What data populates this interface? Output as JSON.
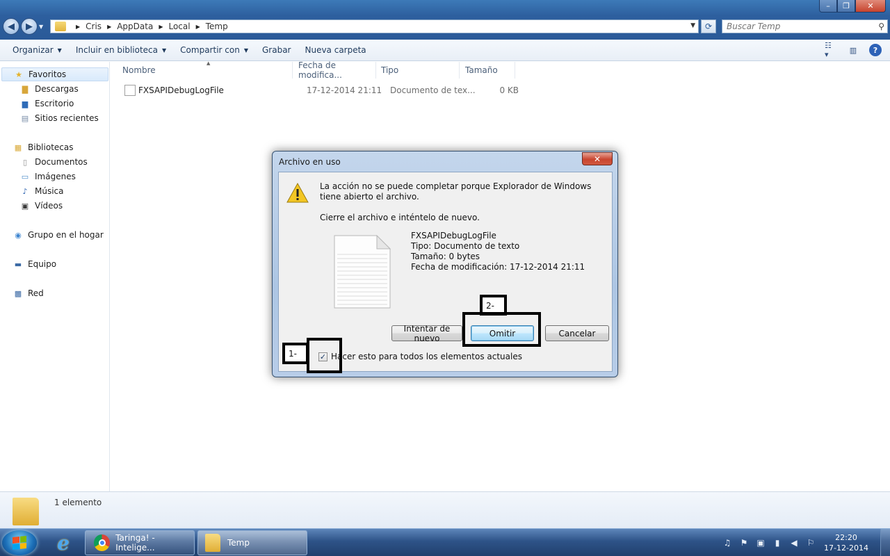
{
  "window": {
    "controls": [
      "–",
      "❐",
      "✕"
    ]
  },
  "address_bar": {
    "crumbs": [
      "Cris",
      "AppData",
      "Local",
      "Temp"
    ]
  },
  "search": {
    "placeholder": "Buscar Temp"
  },
  "command_bar": {
    "items": [
      {
        "label": "Organizar",
        "dropdown": true
      },
      {
        "label": "Incluir en biblioteca",
        "dropdown": true
      },
      {
        "label": "Compartir con",
        "dropdown": true
      },
      {
        "label": "Grabar",
        "dropdown": false
      },
      {
        "label": "Nueva carpeta",
        "dropdown": false
      }
    ]
  },
  "sidebar": {
    "favorites": {
      "label": "Favoritos",
      "items": [
        "Descargas",
        "Escritorio",
        "Sitios recientes"
      ]
    },
    "libraries": {
      "label": "Bibliotecas",
      "items": [
        "Documentos",
        "Imágenes",
        "Música",
        "Vídeos"
      ]
    },
    "homegroup": "Grupo en el hogar",
    "computer": "Equipo",
    "network": "Red"
  },
  "file_list": {
    "columns": [
      "Nombre",
      "Fecha de modifica...",
      "Tipo",
      "Tamaño"
    ],
    "rows": [
      {
        "name": "FXSAPIDebugLogFile",
        "date": "17-12-2014 21:11",
        "type": "Documento de tex...",
        "size": "0 KB"
      }
    ]
  },
  "status_bar": {
    "count": "1 elemento"
  },
  "dialog": {
    "title": "Archivo en uso",
    "message": "La acción no se puede completar porque Explorador de Windows tiene abierto el archivo.",
    "instruction": "Cierre el archivo e inténtelo de nuevo.",
    "file_name": "FXSAPIDebugLogFile",
    "file_type": "Tipo: Documento de texto",
    "file_size": "Tamaño: 0 bytes",
    "file_modified": "Fecha de modificación: 17-12-2014 21:11",
    "buttons": {
      "retry": "Intentar de nuevo",
      "skip": "Omitir",
      "cancel": "Cancelar"
    },
    "checkbox": {
      "label": "Hacer esto para todos los elementos actuales",
      "checked": true
    }
  },
  "annotations": {
    "label1": "1-",
    "label2": "2-"
  },
  "taskbar": {
    "tasks": [
      {
        "label": "Taringa! - Intelige..."
      },
      {
        "label": "Temp"
      }
    ],
    "clock": {
      "time": "22:20",
      "date": "17-12-2014"
    }
  }
}
